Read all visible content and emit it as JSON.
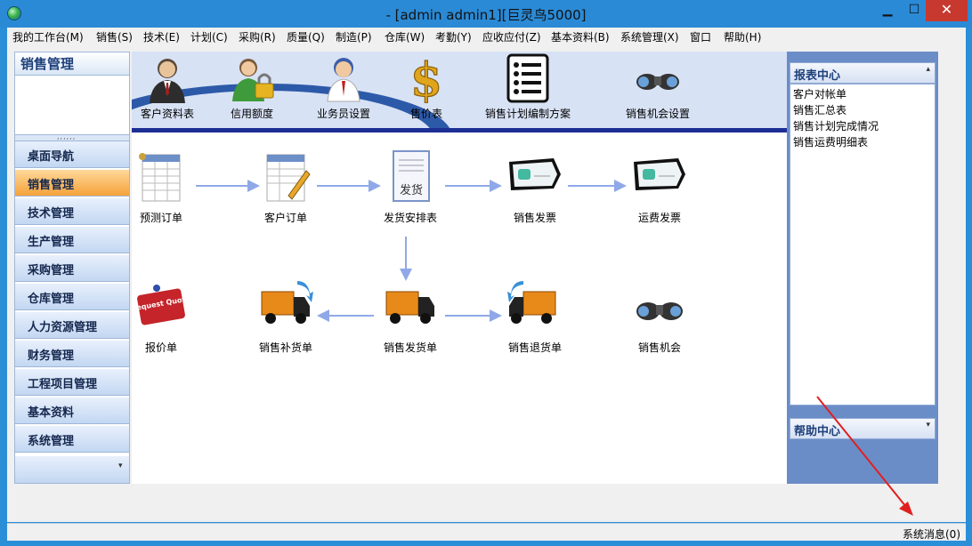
{
  "window": {
    "title": "-  [admin admin1][巨灵鸟5000]",
    "minimize_glyph": "▁",
    "maximize_glyph": "☐",
    "close_glyph": "✕"
  },
  "menubar": {
    "items": [
      "我的工作台(M)",
      "销售(S)",
      "技术(E)",
      "计划(C)",
      "采购(R)",
      "质量(Q)",
      "制造(P)",
      "仓库(W)",
      "考勤(Y)",
      "应收应付(Z)",
      "基本资料(B)",
      "系统管理(X)",
      "窗口",
      "帮助(H)"
    ]
  },
  "left_panel": {
    "title": "销售管理",
    "grip": ",,,,,,",
    "nav": [
      "桌面导航",
      "销售管理",
      "技术管理",
      "生产管理",
      "采购管理",
      "仓库管理",
      "人力资源管理",
      "财务管理",
      "工程项目管理",
      "基本资料",
      "系统管理"
    ],
    "active": "销售管理",
    "footer_caret": "▾"
  },
  "toolbar": {
    "items": [
      {
        "label": "客户资料表",
        "icon": "customer-icon"
      },
      {
        "label": "信用额度",
        "icon": "credit-lock-icon"
      },
      {
        "label": "业务员设置",
        "icon": "salesman-icon"
      },
      {
        "label": "售价表",
        "icon": "dollar-icon"
      },
      {
        "label": "销售计划编制方案",
        "icon": "checklist-icon"
      },
      {
        "label": "销售机会设置",
        "icon": "binoculars-icon"
      }
    ]
  },
  "flow": {
    "items": [
      {
        "label": "预测订单",
        "icon": "forecast-order-icon"
      },
      {
        "label": "客户订单",
        "icon": "customer-order-icon"
      },
      {
        "label": "发货安排表",
        "icon": "shipping-schedule-icon",
        "icon_text": "发货"
      },
      {
        "label": "销售发票",
        "icon": "sales-invoice-icon"
      },
      {
        "label": "运费发票",
        "icon": "freight-invoice-icon"
      },
      {
        "label": "报价单",
        "icon": "request-quote-icon",
        "icon_text": "Request Quote"
      },
      {
        "label": "销售补货单",
        "icon": "replenish-truck-icon"
      },
      {
        "label": "销售发货单",
        "icon": "delivery-truck-icon"
      },
      {
        "label": "销售退货单",
        "icon": "return-truck-icon"
      },
      {
        "label": "销售机会",
        "icon": "binoculars-icon"
      }
    ]
  },
  "right_panel": {
    "report_center": "报表中心",
    "reports": [
      "客户对帐单",
      "销售汇总表",
      "销售计划完成情况",
      "销售运费明细表"
    ],
    "help_center": "帮助中心",
    "collapse_caret": "▴",
    "expand_caret": "▾"
  },
  "statusbar": {
    "message": "系统消息(0)"
  },
  "colors": {
    "accent": "#2a8ad6",
    "active_nav": "#f5a23a",
    "toolbar_bg": "#d8e2f5",
    "flow_arrow": "#8fa8e8"
  }
}
